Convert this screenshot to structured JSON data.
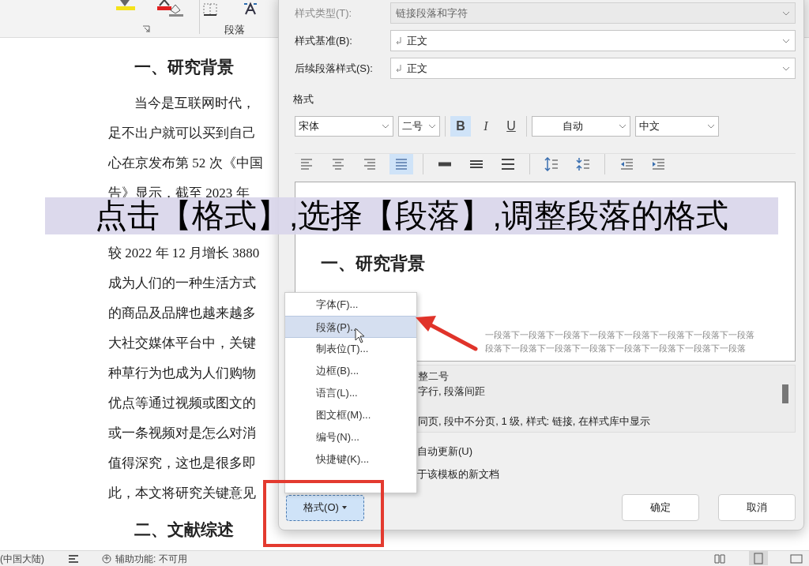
{
  "ribbon": {
    "group_label": "段落"
  },
  "document": {
    "blocks": [
      {
        "kind": "heading",
        "text": "一、研究背景"
      },
      {
        "kind": "first_line",
        "text": "当今是互联网时代，"
      },
      {
        "kind": "line",
        "text": "足不出户就可以买到自己"
      },
      {
        "kind": "line",
        "text": "心在京发布第 52 次《中国"
      },
      {
        "kind": "line",
        "text": "告》显示，截至 2023 年"
      },
      {
        "kind": "gap"
      },
      {
        "kind": "line",
        "text": "较 2022 年 12 月增长 3880"
      },
      {
        "kind": "line",
        "text": "成为人们的一种生活方式"
      },
      {
        "kind": "line",
        "text": "的商品及品牌也越来越多"
      },
      {
        "kind": "line",
        "text": "大社交媒体平台中，关键"
      },
      {
        "kind": "line",
        "text": "种草行为也成为人们购物"
      },
      {
        "kind": "line",
        "text": "优点等通过视频或图文的"
      },
      {
        "kind": "line",
        "text": "或一条视频对是怎么对消"
      },
      {
        "kind": "line",
        "text": "值得深究，这也是很多即"
      },
      {
        "kind": "line",
        "text": "此，本文将研究关键意见"
      },
      {
        "kind": "heading",
        "text": "二、文献综述"
      }
    ]
  },
  "dialog": {
    "fields": [
      {
        "label": "样式类型(T):",
        "value": "链接段落和字符",
        "disabled": true
      },
      {
        "label": "样式基准(B):",
        "value": "正文",
        "disabled": false
      },
      {
        "label": "后续段落样式(S):",
        "value": "正文",
        "disabled": false
      }
    ],
    "section_label": "格式",
    "font": "宋体",
    "size": "二号",
    "toggles": [
      {
        "label": "B",
        "selected": true
      },
      {
        "label": "I",
        "selected": false
      },
      {
        "label": "U",
        "selected": false
      }
    ],
    "font_color_label": "自动",
    "script": "中文",
    "alignments": [
      {
        "kind": "align-left",
        "selected": false
      },
      {
        "kind": "align-center",
        "selected": false
      },
      {
        "kind": "align-right",
        "selected": false
      },
      {
        "kind": "justify",
        "selected": true
      },
      {
        "kind": "single-spacing",
        "selected": false
      },
      {
        "kind": "one-half-spacing",
        "selected": false
      },
      {
        "kind": "double-spacing",
        "selected": false
      },
      {
        "kind": "increase-spacing",
        "selected": false
      },
      {
        "kind": "decrease-spacing",
        "selected": false
      },
      {
        "kind": "decrease-indent",
        "selected": false
      },
      {
        "kind": "increase-indent",
        "selected": false
      }
    ],
    "preview": {
      "heading": "一、研究背景",
      "after_lines": [
        "一段落下一段落下一段落下一段落下一段落下一段落下一段落下一段落",
        "段落下一段落下一段落下一段落下一段落下一段落下一段落下一段落"
      ]
    },
    "description": [
      "整二号",
      "字行, 段落间距",
      "同页, 段中不分页, 1 级, 样式: 链接, 在样式库中显示"
    ],
    "options": [
      "自动更新(U)",
      "于该模板的新文档"
    ],
    "format_button": "格式(O)",
    "buttons": [
      "确定",
      "取消"
    ]
  },
  "menu": {
    "items": [
      {
        "label": "字体(F)...",
        "selected": false
      },
      {
        "label": "段落(P)...",
        "selected": true
      },
      {
        "label": "制表位(T)...",
        "selected": false
      },
      {
        "label": "边框(B)...",
        "selected": false
      },
      {
        "label": "语言(L)...",
        "selected": false
      },
      {
        "label": "图文框(M)...",
        "selected": false
      },
      {
        "label": "编号(N)...",
        "selected": false
      },
      {
        "label": "快捷键(K)...",
        "selected": false
      }
    ]
  },
  "subtitle": "点击【格式】,选择【段落】,调整段落的格式",
  "status_bar": {
    "language": "(中国大陆)",
    "accessibility": "辅助功能: 不可用"
  }
}
